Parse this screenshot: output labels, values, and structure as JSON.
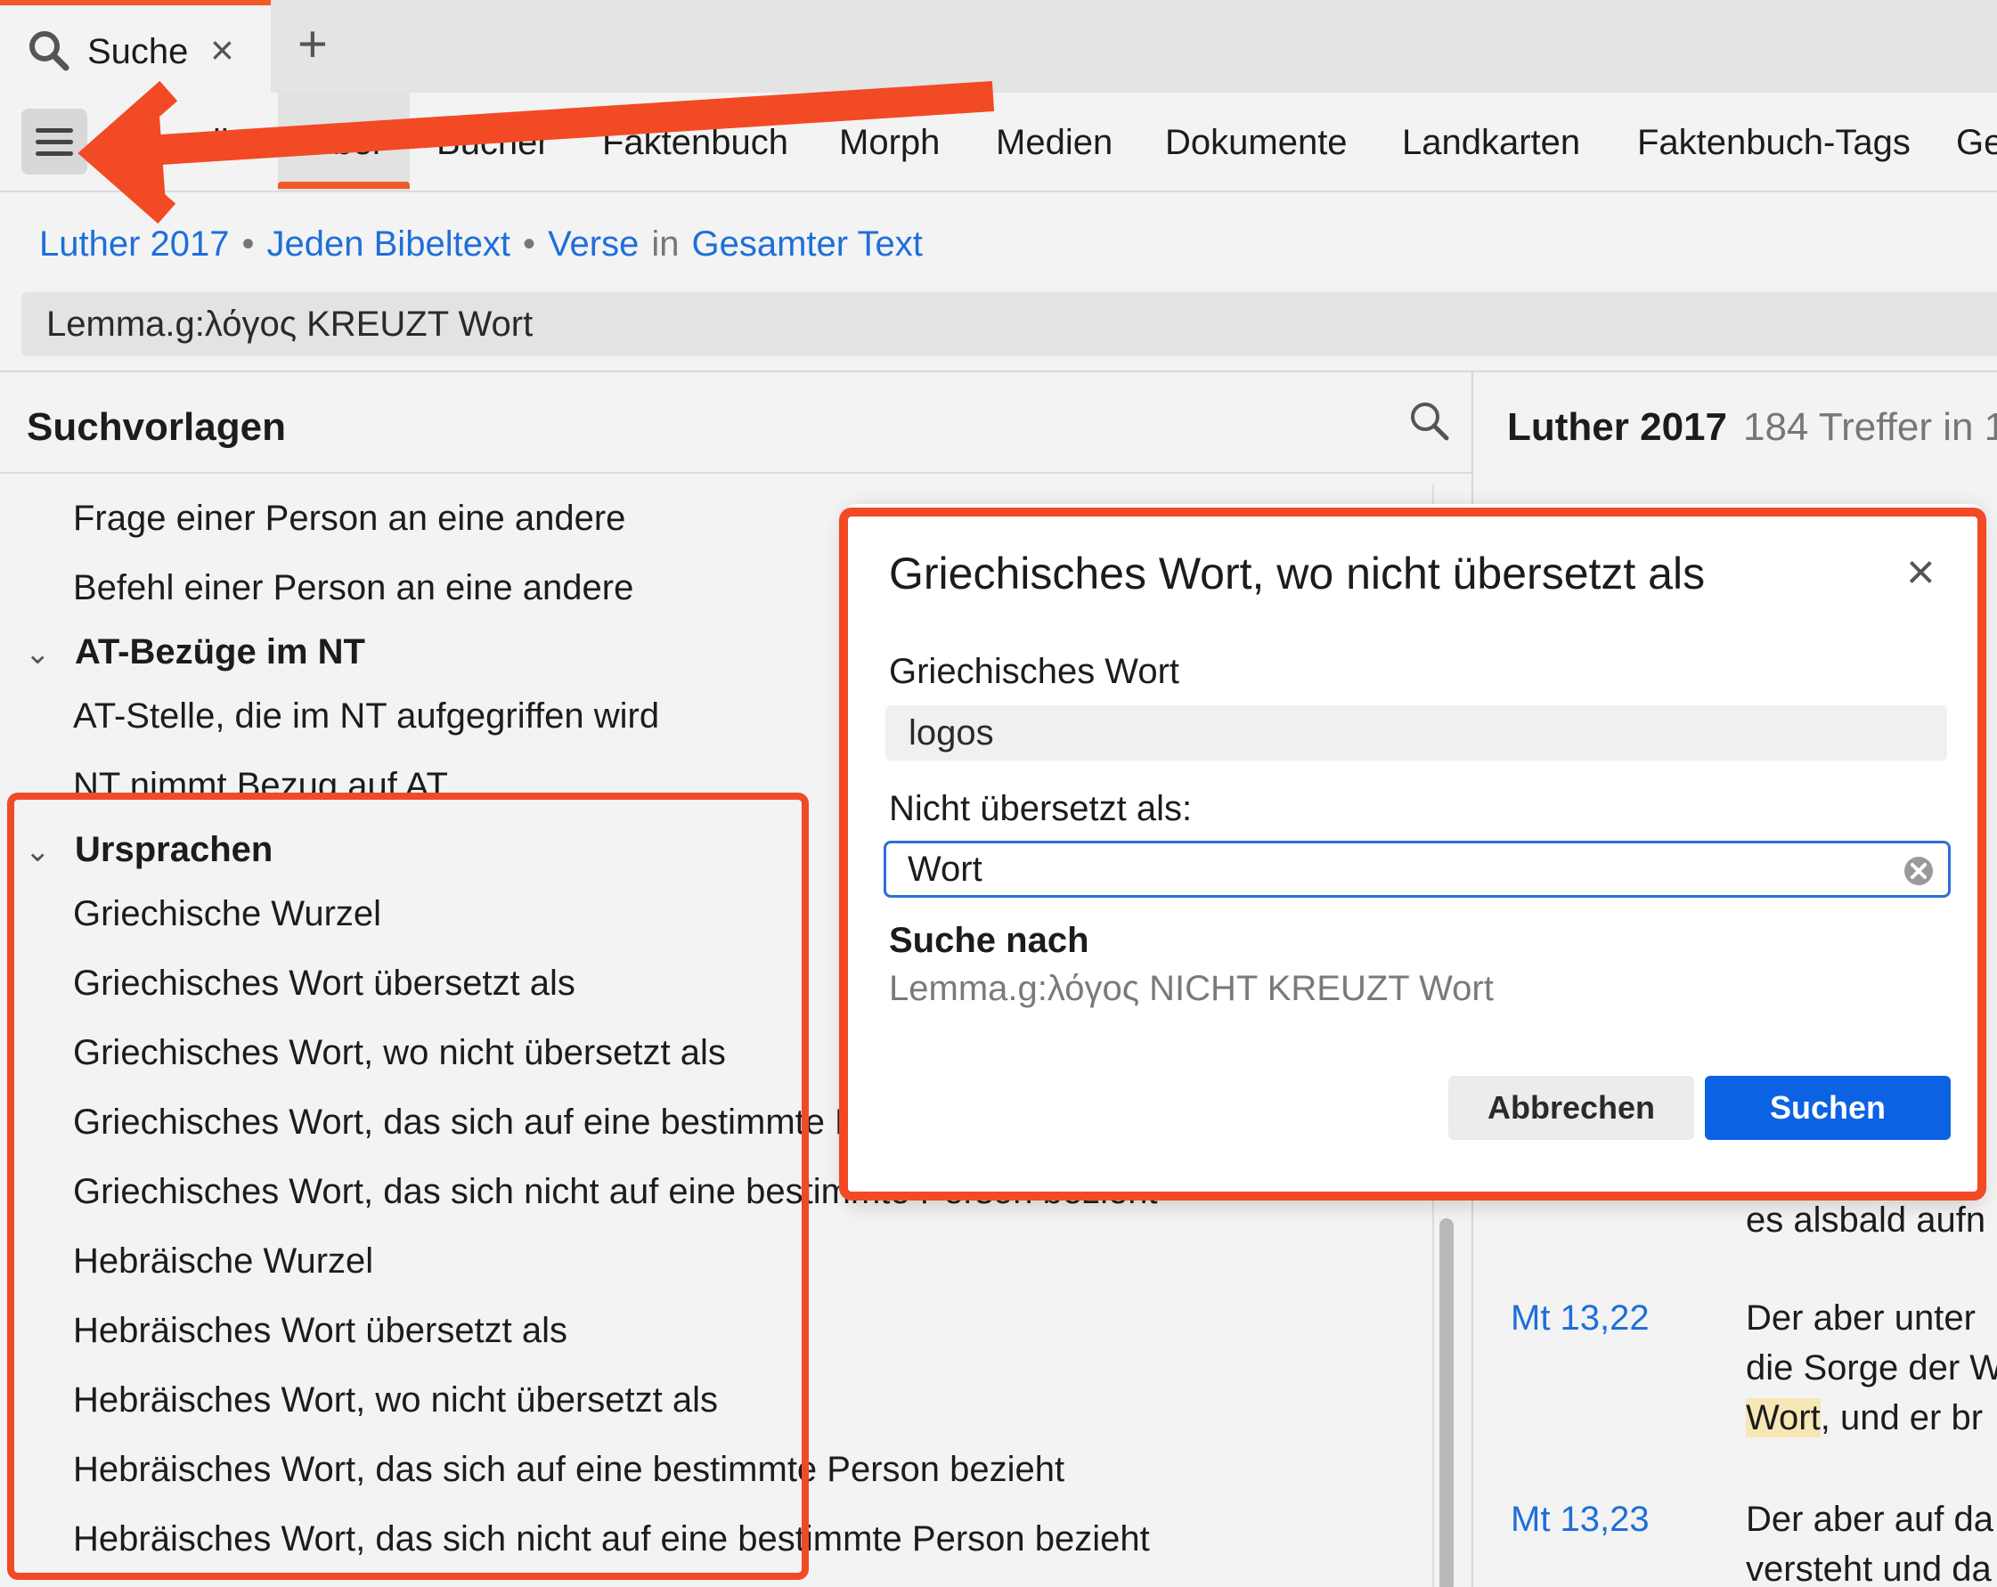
{
  "tab": {
    "title": "Suche",
    "close": "×",
    "new": "+"
  },
  "categories": [
    "Überall",
    "Bibel",
    "Bücher",
    "Faktenbuch",
    "Morph",
    "Medien",
    "Dokumente",
    "Landkarten",
    "Faktenbuch-Tags",
    "Ge"
  ],
  "scope": {
    "bible": "Luther 2017",
    "text": "Jeden Bibeltext",
    "unit": "Verse",
    "in": "in",
    "range": "Gesamter Text",
    "sep": "•"
  },
  "query": "Lemma.g:λόγος KREUZT Wort",
  "templates": {
    "title": "Suchvorlagen",
    "items_top": [
      "Frage einer Person an eine andere",
      "Befehl einer Person an eine andere"
    ],
    "group1": {
      "label": "AT-Bezüge im NT",
      "items": [
        "AT-Stelle, die im NT aufgegriffen wird",
        "NT nimmt Bezug auf AT"
      ]
    },
    "group2": {
      "label": "Ursprachen",
      "items": [
        "Griechische Wurzel",
        "Griechisches Wort übersetzt als",
        "Griechisches Wort, wo nicht übersetzt als",
        "Griechisches Wort, das sich auf eine bestimmte Person bezieht",
        "Griechisches Wort, das sich nicht auf eine bestimmte Person bezieht",
        "Hebräische Wurzel",
        "Hebräisches Wort übersetzt als",
        "Hebräisches Wort, wo nicht übersetzt als",
        "Hebräisches Wort, das sich auf eine bestimmte Person bezieht",
        "Hebräisches Wort, das sich nicht auf eine bestimmte Person bezieht"
      ]
    }
  },
  "results": {
    "bible": "Luther 2017",
    "count": "184 Treffer in 1",
    "rows": [
      {
        "ref": "",
        "lines": [
          "es alsbald aufn"
        ]
      },
      {
        "ref": "Mt 13,22",
        "lines": [
          "Der aber unter",
          "die Sorge der W"
        ],
        "hl": "Wort",
        "tail": ", und er br"
      },
      {
        "ref": "Mt 13,23",
        "lines": [
          "Der aber auf da",
          "versteht und da"
        ]
      }
    ]
  },
  "dialog": {
    "title": "Griechisches Wort, wo nicht übersetzt als",
    "close": "×",
    "label1": "Griechisches Wort",
    "value1": "logos",
    "label2": "Nicht übersetzt als:",
    "value2": "Wort",
    "preview_label": "Suche nach",
    "preview": "Lemma.g:λόγος NICHT KREUZT Wort",
    "cancel": "Abbrechen",
    "submit": "Suchen"
  },
  "colors": {
    "accent": "#f05a28",
    "link": "#1e6fd9",
    "primary": "#0b63e3",
    "annotation": "#f24a25"
  }
}
